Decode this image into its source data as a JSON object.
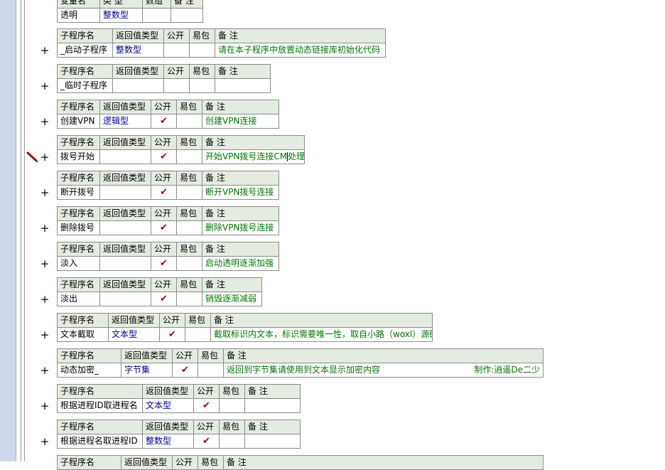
{
  "var_table": {
    "headers": [
      "变量名",
      "类 型",
      "数组",
      "备 注"
    ],
    "row": [
      "透明",
      "整数型",
      "",
      ""
    ]
  },
  "sub_headers": [
    "子程序名",
    "返回值类型",
    "公开",
    "易包",
    "备 注"
  ],
  "plus_symbol": "+",
  "check_symbol": "✔",
  "subs": [
    {
      "name": "_启动子程序",
      "type": "整数型",
      "public": false,
      "remark": "请在本子程序中放置动态链接库初始化代码"
    },
    {
      "name": "_临时子程序",
      "type": "",
      "public": false,
      "remark": ""
    },
    {
      "name": "创建VPN",
      "type": "逻辑型",
      "public": true,
      "remark": "创建VPN连接"
    },
    {
      "name": "拨号开始",
      "type": "",
      "public": true,
      "remark_before_cursor": "开始VPN拨号连接CM",
      "remark_after_cursor": "处理"
    },
    {
      "name": "断开拨号",
      "type": "",
      "public": true,
      "remark": "断开VPN拨号连接"
    },
    {
      "name": "删除拨号",
      "type": "",
      "public": true,
      "remark": "删除VPN拨号连接"
    },
    {
      "name": "淡入",
      "type": "",
      "public": true,
      "remark": "启动透明逐渐加强"
    },
    {
      "name": "淡出",
      "type": "",
      "public": true,
      "remark": "销毁逐渐减弱"
    },
    {
      "name": "文本截取",
      "type": "文本型",
      "public": true,
      "remark": "截取标识内文本，标识需要唯一性，取自小路（woxl）源码"
    },
    {
      "name": "动态加密_",
      "type": "字节集",
      "public": true,
      "remark": "返回到字节集请使用到文本显示加密内容",
      "author": "制作:逍遥De二少"
    },
    {
      "name": "根据进程ID取进程名",
      "type": "文本型",
      "public": true,
      "remark": ""
    },
    {
      "name": "根据进程名取进程ID",
      "type": "整数型",
      "public": true,
      "remark": ""
    }
  ],
  "colors": {
    "header_bg": "#e4ebe0",
    "type_text": "#000096",
    "remark_text": "#007800",
    "check_mark": "#a0001e",
    "gutter_bg": "#cdd9ea"
  },
  "icons": {
    "breakpoint": "pen-icon",
    "expand": "plus-icon"
  }
}
